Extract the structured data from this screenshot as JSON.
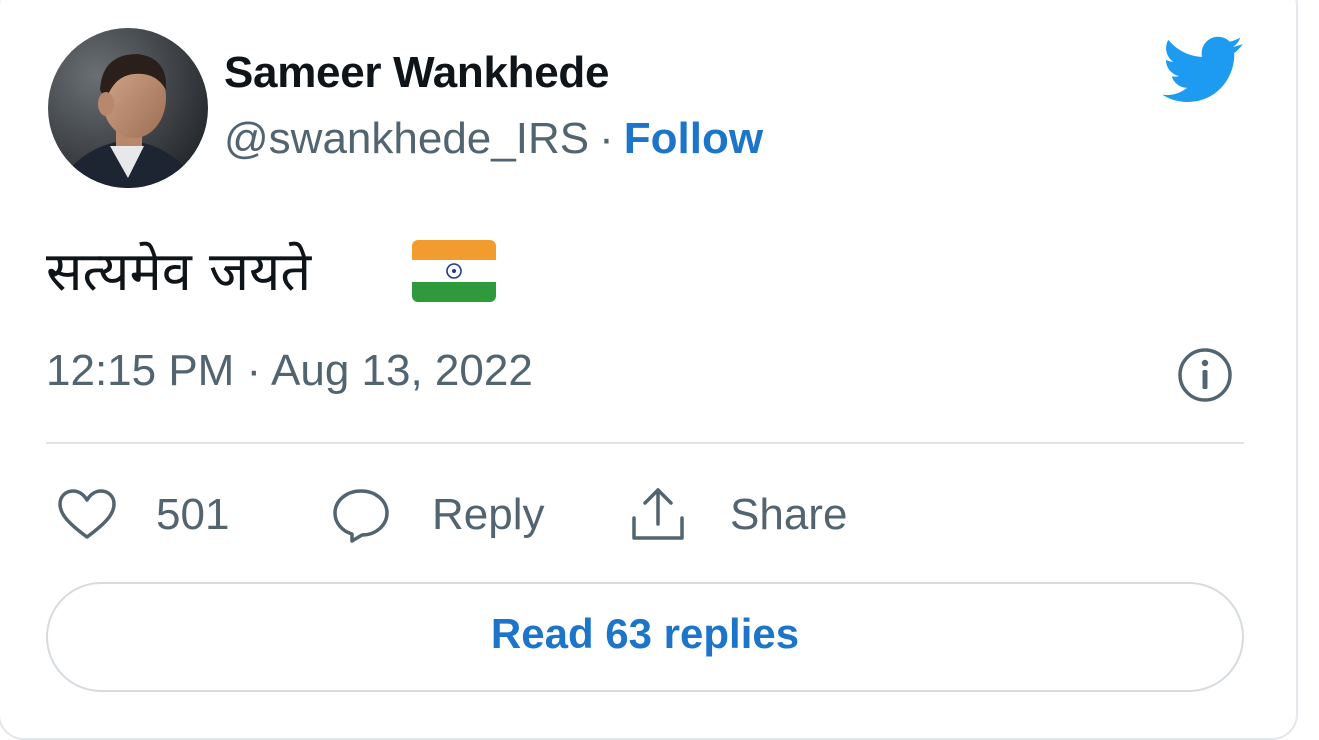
{
  "author": {
    "display_name": "Sameer Wankhede",
    "handle": "@swankhede_IRS",
    "separator": "·",
    "follow_label": "Follow"
  },
  "tweet": {
    "text": "सत्यमेव जयते",
    "flag_icon": "india-flag-emoji",
    "timestamp": "12:15 PM · Aug 13, 2022"
  },
  "actions": {
    "like_count": "501",
    "reply_label": "Reply",
    "share_label": "Share"
  },
  "footer": {
    "read_replies_label": "Read 63 replies"
  },
  "icons": {
    "brand": "twitter-bird-icon",
    "info": "info-icon",
    "like": "heart-icon",
    "reply": "speech-bubble-icon",
    "share": "share-icon"
  },
  "colors": {
    "brand_blue": "#1d9bf0",
    "link_blue": "#1d75c9",
    "text_primary": "#0f1419",
    "text_secondary": "#536471",
    "saffron": "#f29b2e",
    "india_green": "#2e9a3c",
    "chakra_navy": "#1f3c88"
  }
}
